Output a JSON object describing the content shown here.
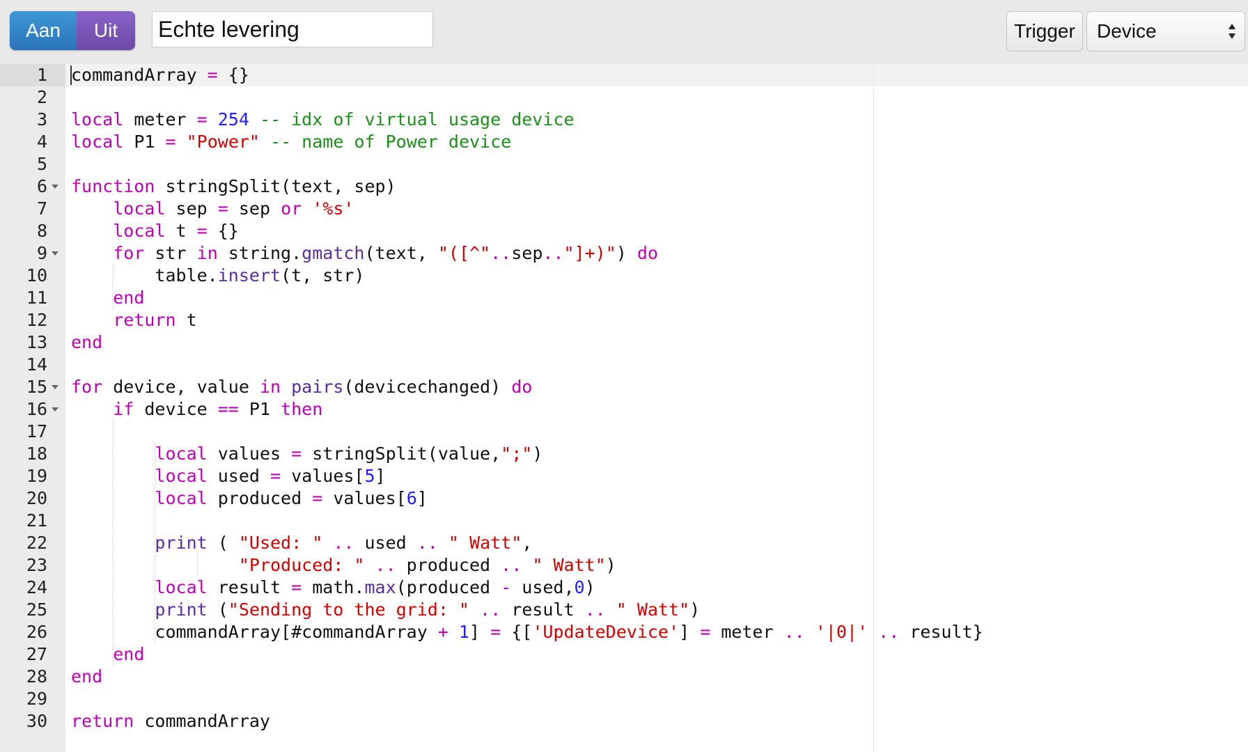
{
  "toolbar": {
    "on_label": "Aan",
    "off_label": "Uit",
    "script_name": "Echte levering",
    "trigger_label": "Trigger",
    "trigger_type": "Device"
  },
  "editor": {
    "colors": {
      "keyword": "#c000b7",
      "number": "#2020ff",
      "string": "#d40000",
      "comment": "#1a8f1a",
      "function": "#5a2da0",
      "text": "#111111"
    },
    "fold_lines": [
      6,
      9,
      15,
      16
    ],
    "lines": [
      {
        "n": "1",
        "t": [
          [
            "plain",
            "commandArray "
          ],
          [
            "op",
            "="
          ],
          [
            "plain",
            " {}"
          ]
        ]
      },
      {
        "n": "2",
        "t": []
      },
      {
        "n": "3",
        "t": [
          [
            "kw",
            "local"
          ],
          [
            "plain",
            " meter "
          ],
          [
            "op",
            "="
          ],
          [
            "plain",
            " "
          ],
          [
            "num",
            "254"
          ],
          [
            "plain",
            " "
          ],
          [
            "com",
            "-- idx of virtual usage device"
          ]
        ]
      },
      {
        "n": "4",
        "t": [
          [
            "kw",
            "local"
          ],
          [
            "plain",
            " P1 "
          ],
          [
            "op",
            "="
          ],
          [
            "plain",
            " "
          ],
          [
            "str",
            "\"Power\""
          ],
          [
            "plain",
            " "
          ],
          [
            "com",
            "-- name of Power device"
          ]
        ]
      },
      {
        "n": "5",
        "t": []
      },
      {
        "n": "6",
        "t": [
          [
            "kw",
            "function"
          ],
          [
            "plain",
            " stringSplit(text, sep)"
          ]
        ]
      },
      {
        "n": "7",
        "t": [
          [
            "plain",
            "    "
          ],
          [
            "kw",
            "local"
          ],
          [
            "plain",
            " sep "
          ],
          [
            "op",
            "="
          ],
          [
            "plain",
            " sep "
          ],
          [
            "kw",
            "or"
          ],
          [
            "plain",
            " "
          ],
          [
            "str",
            "'%s'"
          ]
        ]
      },
      {
        "n": "8",
        "t": [
          [
            "plain",
            "    "
          ],
          [
            "kw",
            "local"
          ],
          [
            "plain",
            " t "
          ],
          [
            "op",
            "="
          ],
          [
            "plain",
            " {}"
          ]
        ]
      },
      {
        "n": "9",
        "t": [
          [
            "plain",
            "    "
          ],
          [
            "kw",
            "for"
          ],
          [
            "plain",
            " str "
          ],
          [
            "kw",
            "in"
          ],
          [
            "plain",
            " string."
          ],
          [
            "fn",
            "gmatch"
          ],
          [
            "plain",
            "(text, "
          ],
          [
            "str",
            "\"([^\""
          ],
          [
            "op",
            ".."
          ],
          [
            "plain",
            "sep"
          ],
          [
            "op",
            ".."
          ],
          [
            "str",
            "\"]+)\""
          ],
          [
            "plain",
            ") "
          ],
          [
            "kw",
            "do"
          ]
        ]
      },
      {
        "n": "10",
        "t": [
          [
            "plain",
            "        table."
          ],
          [
            "fn",
            "insert"
          ],
          [
            "plain",
            "(t, str)"
          ]
        ]
      },
      {
        "n": "11",
        "t": [
          [
            "plain",
            "    "
          ],
          [
            "kw",
            "end"
          ]
        ]
      },
      {
        "n": "12",
        "t": [
          [
            "plain",
            "    "
          ],
          [
            "kw",
            "return"
          ],
          [
            "plain",
            " t"
          ]
        ]
      },
      {
        "n": "13",
        "t": [
          [
            "kw",
            "end"
          ]
        ]
      },
      {
        "n": "14",
        "t": []
      },
      {
        "n": "15",
        "t": [
          [
            "kw",
            "for"
          ],
          [
            "plain",
            " device, value "
          ],
          [
            "kw",
            "in"
          ],
          [
            "plain",
            " "
          ],
          [
            "fn",
            "pairs"
          ],
          [
            "plain",
            "(devicechanged) "
          ],
          [
            "kw",
            "do"
          ]
        ]
      },
      {
        "n": "16",
        "t": [
          [
            "plain",
            "    "
          ],
          [
            "kw",
            "if"
          ],
          [
            "plain",
            " device "
          ],
          [
            "op",
            "=="
          ],
          [
            "plain",
            " P1 "
          ],
          [
            "kw",
            "then"
          ]
        ]
      },
      {
        "n": "17",
        "t": []
      },
      {
        "n": "18",
        "t": [
          [
            "plain",
            "        "
          ],
          [
            "kw",
            "local"
          ],
          [
            "plain",
            " values "
          ],
          [
            "op",
            "="
          ],
          [
            "plain",
            " stringSplit(value,"
          ],
          [
            "str",
            "\";\""
          ],
          [
            "plain",
            ")"
          ]
        ]
      },
      {
        "n": "19",
        "t": [
          [
            "plain",
            "        "
          ],
          [
            "kw",
            "local"
          ],
          [
            "plain",
            " used "
          ],
          [
            "op",
            "="
          ],
          [
            "plain",
            " values["
          ],
          [
            "num",
            "5"
          ],
          [
            "plain",
            "]"
          ]
        ]
      },
      {
        "n": "20",
        "t": [
          [
            "plain",
            "        "
          ],
          [
            "kw",
            "local"
          ],
          [
            "plain",
            " produced "
          ],
          [
            "op",
            "="
          ],
          [
            "plain",
            " values["
          ],
          [
            "num",
            "6"
          ],
          [
            "plain",
            "]"
          ]
        ]
      },
      {
        "n": "21",
        "t": []
      },
      {
        "n": "22",
        "t": [
          [
            "plain",
            "        "
          ],
          [
            "fn",
            "print"
          ],
          [
            "plain",
            " ( "
          ],
          [
            "str",
            "\"Used: \""
          ],
          [
            "plain",
            " "
          ],
          [
            "op",
            ".."
          ],
          [
            "plain",
            " used "
          ],
          [
            "op",
            ".."
          ],
          [
            "plain",
            " "
          ],
          [
            "str",
            "\" Watt\""
          ],
          [
            "plain",
            ","
          ]
        ]
      },
      {
        "n": "23",
        "t": [
          [
            "plain",
            "                "
          ],
          [
            "str",
            "\"Produced: \""
          ],
          [
            "plain",
            " "
          ],
          [
            "op",
            ".."
          ],
          [
            "plain",
            " produced "
          ],
          [
            "op",
            ".."
          ],
          [
            "plain",
            " "
          ],
          [
            "str",
            "\" Watt\""
          ],
          [
            "plain",
            ")"
          ]
        ]
      },
      {
        "n": "24",
        "t": [
          [
            "plain",
            "        "
          ],
          [
            "kw",
            "local"
          ],
          [
            "plain",
            " result "
          ],
          [
            "op",
            "="
          ],
          [
            "plain",
            " math."
          ],
          [
            "fn",
            "max"
          ],
          [
            "plain",
            "(produced "
          ],
          [
            "op",
            "-"
          ],
          [
            "plain",
            " used,"
          ],
          [
            "num",
            "0"
          ],
          [
            "plain",
            ")"
          ]
        ]
      },
      {
        "n": "25",
        "t": [
          [
            "plain",
            "        "
          ],
          [
            "fn",
            "print"
          ],
          [
            "plain",
            " ("
          ],
          [
            "str",
            "\"Sending to the grid: \""
          ],
          [
            "plain",
            " "
          ],
          [
            "op",
            ".."
          ],
          [
            "plain",
            " result "
          ],
          [
            "op",
            ".."
          ],
          [
            "plain",
            " "
          ],
          [
            "str",
            "\" Watt\""
          ],
          [
            "plain",
            ")"
          ]
        ]
      },
      {
        "n": "26",
        "t": [
          [
            "plain",
            "        commandArray[#commandArray "
          ],
          [
            "op",
            "+"
          ],
          [
            "plain",
            " "
          ],
          [
            "num",
            "1"
          ],
          [
            "plain",
            "] "
          ],
          [
            "op",
            "="
          ],
          [
            "plain",
            " {["
          ],
          [
            "str",
            "'UpdateDevice'"
          ],
          [
            "plain",
            "] "
          ],
          [
            "op",
            "="
          ],
          [
            "plain",
            " meter "
          ],
          [
            "op",
            ".."
          ],
          [
            "plain",
            " "
          ],
          [
            "str",
            "'|0|'"
          ],
          [
            "plain",
            " "
          ],
          [
            "op",
            ".."
          ],
          [
            "plain",
            " result}"
          ]
        ]
      },
      {
        "n": "27",
        "t": [
          [
            "plain",
            "    "
          ],
          [
            "kw",
            "end"
          ]
        ]
      },
      {
        "n": "28",
        "t": [
          [
            "kw",
            "end"
          ]
        ]
      },
      {
        "n": "29",
        "t": []
      },
      {
        "n": "30",
        "t": [
          [
            "kw",
            "return"
          ],
          [
            "plain",
            " commandArray"
          ]
        ]
      }
    ]
  }
}
